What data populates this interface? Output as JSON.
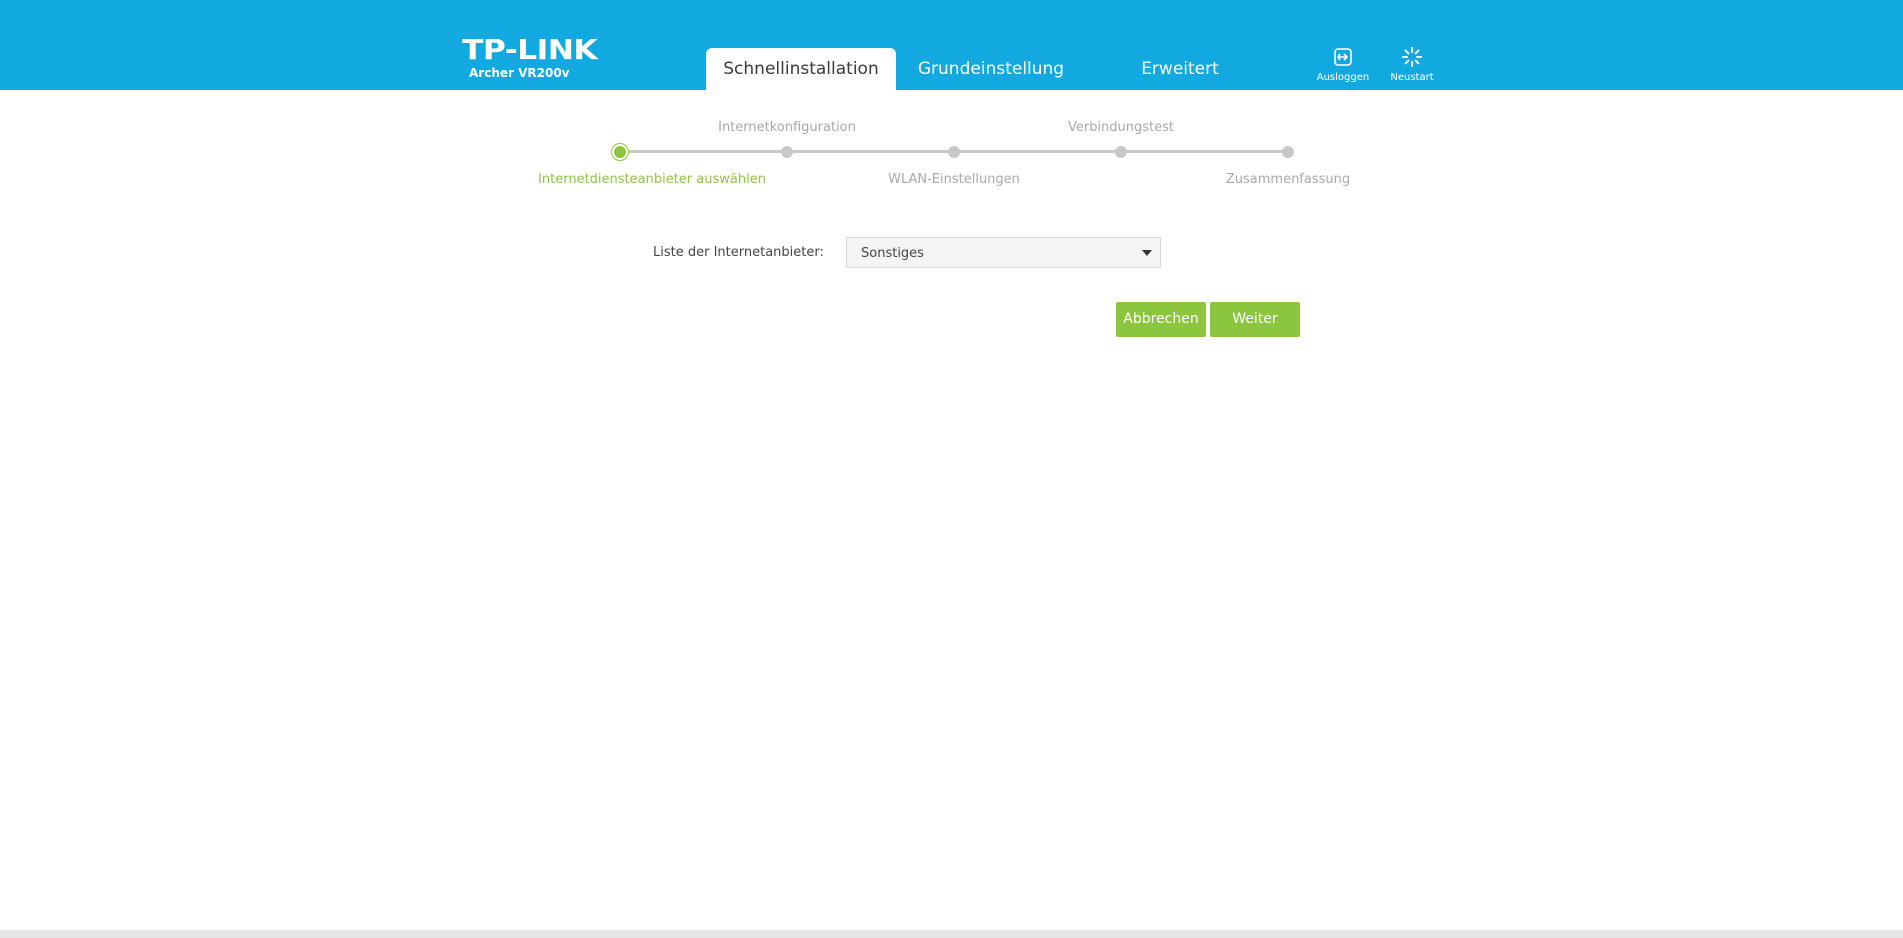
{
  "brand": {
    "logo": "TP-LINK",
    "model": "Archer VR200v"
  },
  "nav": {
    "tabs": [
      {
        "label": "Schnellinstallation",
        "active": true
      },
      {
        "label": "Grundeinstellung",
        "active": false
      },
      {
        "label": "Erweitert",
        "active": false
      }
    ],
    "logout_label": "Ausloggen",
    "reboot_label": "Neustart"
  },
  "stepper": {
    "steps": [
      {
        "label": "Internetdiensteanbieter auswählen",
        "active": true
      },
      {
        "label": "Internetkonfiguration",
        "active": false
      },
      {
        "label": "WLAN-Einstellungen",
        "active": false
      },
      {
        "label": "Verbindungstest",
        "active": false
      },
      {
        "label": "Zusammenfassung",
        "active": false
      }
    ]
  },
  "form": {
    "isp_label": "Liste der Internetanbieter:",
    "isp_value": "Sonstiges"
  },
  "actions": {
    "cancel_label": "Abbrechen",
    "next_label": "Weiter"
  },
  "colors": {
    "header_bg": "#12a9e0",
    "accent_green": "#8cc63f",
    "inactive_gray": "#c8c8c8"
  }
}
